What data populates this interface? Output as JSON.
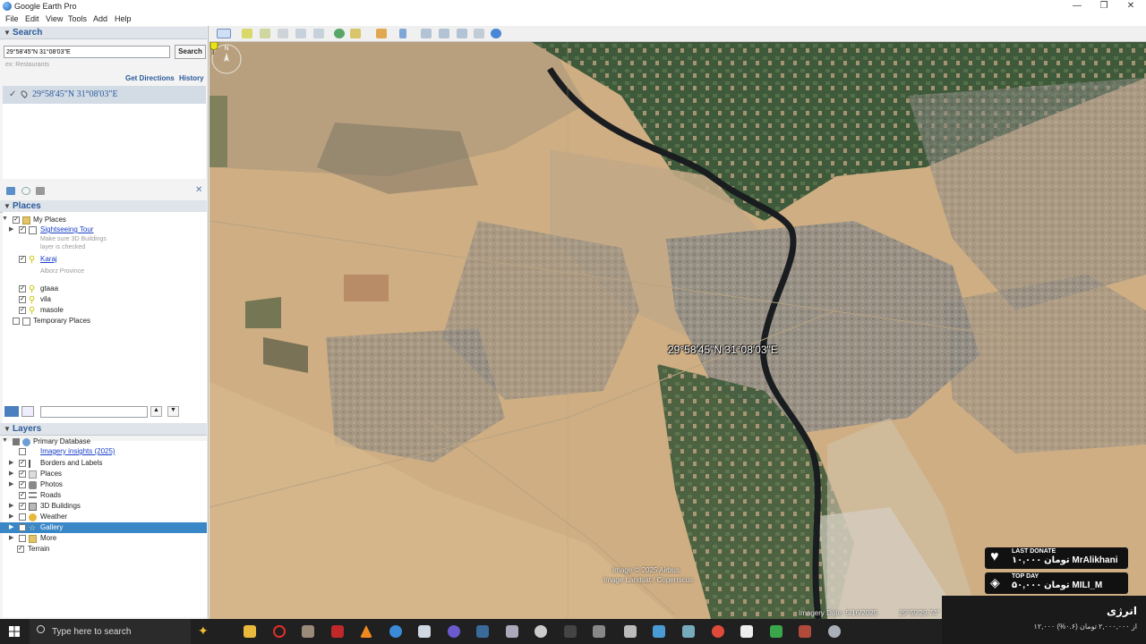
{
  "window": {
    "title": "Google Earth Pro",
    "controls": {
      "minimize": "—",
      "restore": "❐",
      "close": "✕"
    }
  },
  "menu": [
    "File",
    "Edit",
    "View",
    "Tools",
    "Add",
    "Help"
  ],
  "search_panel": {
    "header": "Search",
    "input_value": "29°58'45\"N 31°08'03\"E",
    "button": "Search",
    "hint": "ex: Restaurants",
    "get_directions": "Get Directions",
    "history": "History",
    "result": "29°58'45\"N 31°08'03\"E"
  },
  "places_panel": {
    "header": "Places",
    "items": {
      "my_places": "My Places",
      "sightseeing": "Sightseeing Tour",
      "sightseeing_note_1": "Make sure 3D Buildings",
      "sightseeing_note_2": "layer is checked",
      "karaj": "Karaj",
      "karaj_note": "Alborz Province",
      "gtaaa": "gtaaa",
      "vila": "vila",
      "masole": "masole",
      "temporary": "Temporary Places"
    }
  },
  "layers_panel": {
    "header": "Layers",
    "items": {
      "primary": "Primary Database",
      "imagery": "Imagery insights (2025)",
      "borders": "Borders and Labels",
      "places": "Places",
      "photos": "Photos",
      "roads": "Roads",
      "buildings": "3D Buildings",
      "weather": "Weather",
      "gallery": "Gallery",
      "more": "More",
      "terrain": "Terrain"
    }
  },
  "map": {
    "placemark_label": "29°58'45\"N 31°08'03\"E",
    "attribution_1": "Image © 2025 Airbus",
    "attribution_2": "Image Landsat / Copernicus",
    "imagery_date": "Imagery Date: 5/16/2025",
    "coords_status": "29°59'29.74\""
  },
  "overlay": {
    "last_donate_heading": "LAST DONATE",
    "last_donate_value": "تومان ۱۰,۰۰۰  MrAlikhani",
    "top_day_heading": "TOP DAY",
    "top_day_value": "تومان ۵۰,۰۰۰  MILI_M",
    "energy_title": "انرژی",
    "energy_detail": "۱۲,۰۰۰ از ۲,۰۰۰,۰۰۰ تومان (۰.۶%)"
  },
  "taskbar": {
    "search_placeholder": "Type here to search"
  },
  "colors": {
    "panel_header_text": "#2c5b9a",
    "selection": "#3a87c8",
    "desert": "#cfae83",
    "vegetation": "#3f5a3a",
    "river": "#1a1d20"
  }
}
